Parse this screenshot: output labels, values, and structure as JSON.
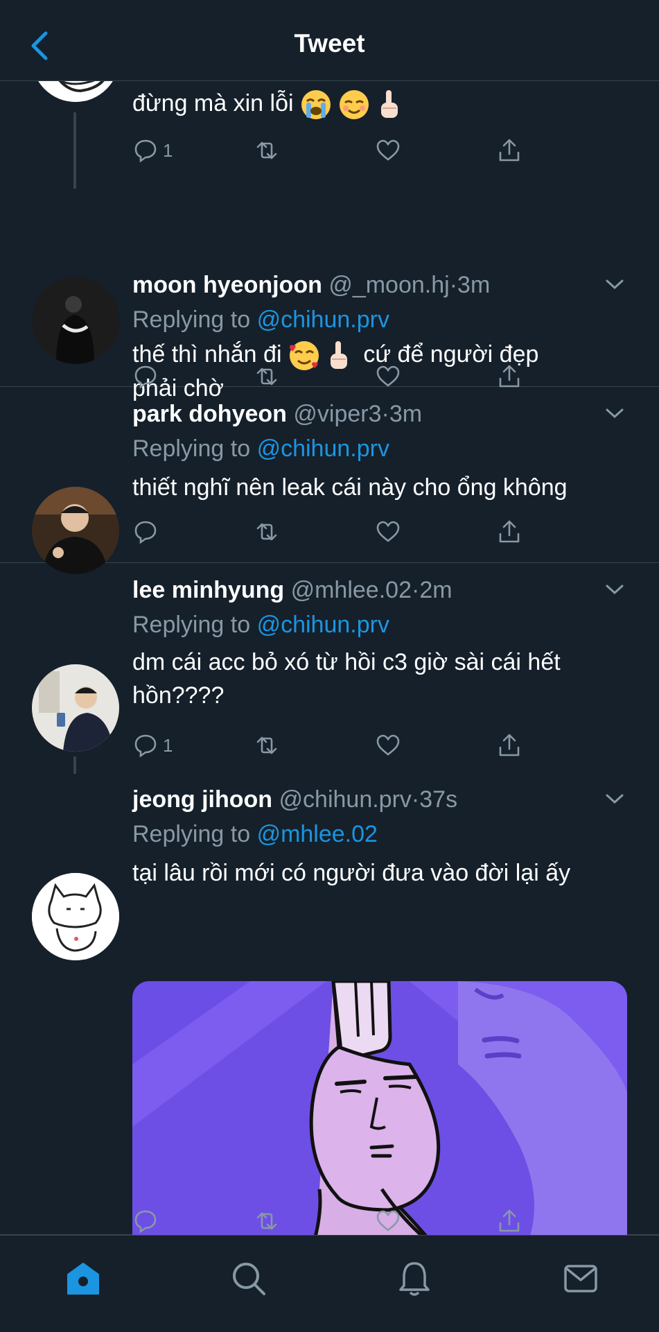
{
  "header": {
    "title": "Tweet"
  },
  "tweets": [
    {
      "text": "đừng mà xin lỗi",
      "emojis": [
        "loudly-crying-face",
        "smiling-face",
        "middle-finger"
      ],
      "reply_count": "1"
    },
    {
      "name": "moon hyeonjoon",
      "handle": "@_moon.hj",
      "time": "3m",
      "replying_prefix": "Replying to",
      "replying_to": "@chihun.prv",
      "text_a": "thế thì nhắn đi",
      "emojis": [
        "smiling-face-with-hearts",
        "middle-finger"
      ],
      "text_b": "cứ để người đẹp",
      "text_c": "phải chờ"
    },
    {
      "name": "park dohyeon",
      "handle": "@viper3",
      "time": "3m",
      "replying_prefix": "Replying to",
      "replying_to": "@chihun.prv",
      "text": "thiết nghĩ nên leak cái này cho ổng không"
    },
    {
      "name": "lee minhyung",
      "handle": "@mhlee.02",
      "time": "2m",
      "replying_prefix": "Replying to",
      "replying_to": "@chihun.prv",
      "text_a": "dm cái acc bỏ xó từ hồi c3 giờ sài cái hết",
      "text_b": "hồn????",
      "reply_count": "1"
    },
    {
      "name": "jeong jihoon",
      "handle": "@chihun.prv",
      "time": "37s",
      "replying_prefix": "Replying to",
      "replying_to": "@mhlee.02",
      "text": "tại lâu rồi mới có người đưa vào đời lại ấy",
      "media": "rabbit-meme-image"
    }
  ],
  "sep": "·",
  "tabbar": [
    "home-icon",
    "search-icon",
    "notifications-icon",
    "messages-icon"
  ],
  "colors": {
    "background": "#15202b",
    "accent": "#1b95e0",
    "muted": "#8899a6",
    "divider": "#38444d"
  }
}
